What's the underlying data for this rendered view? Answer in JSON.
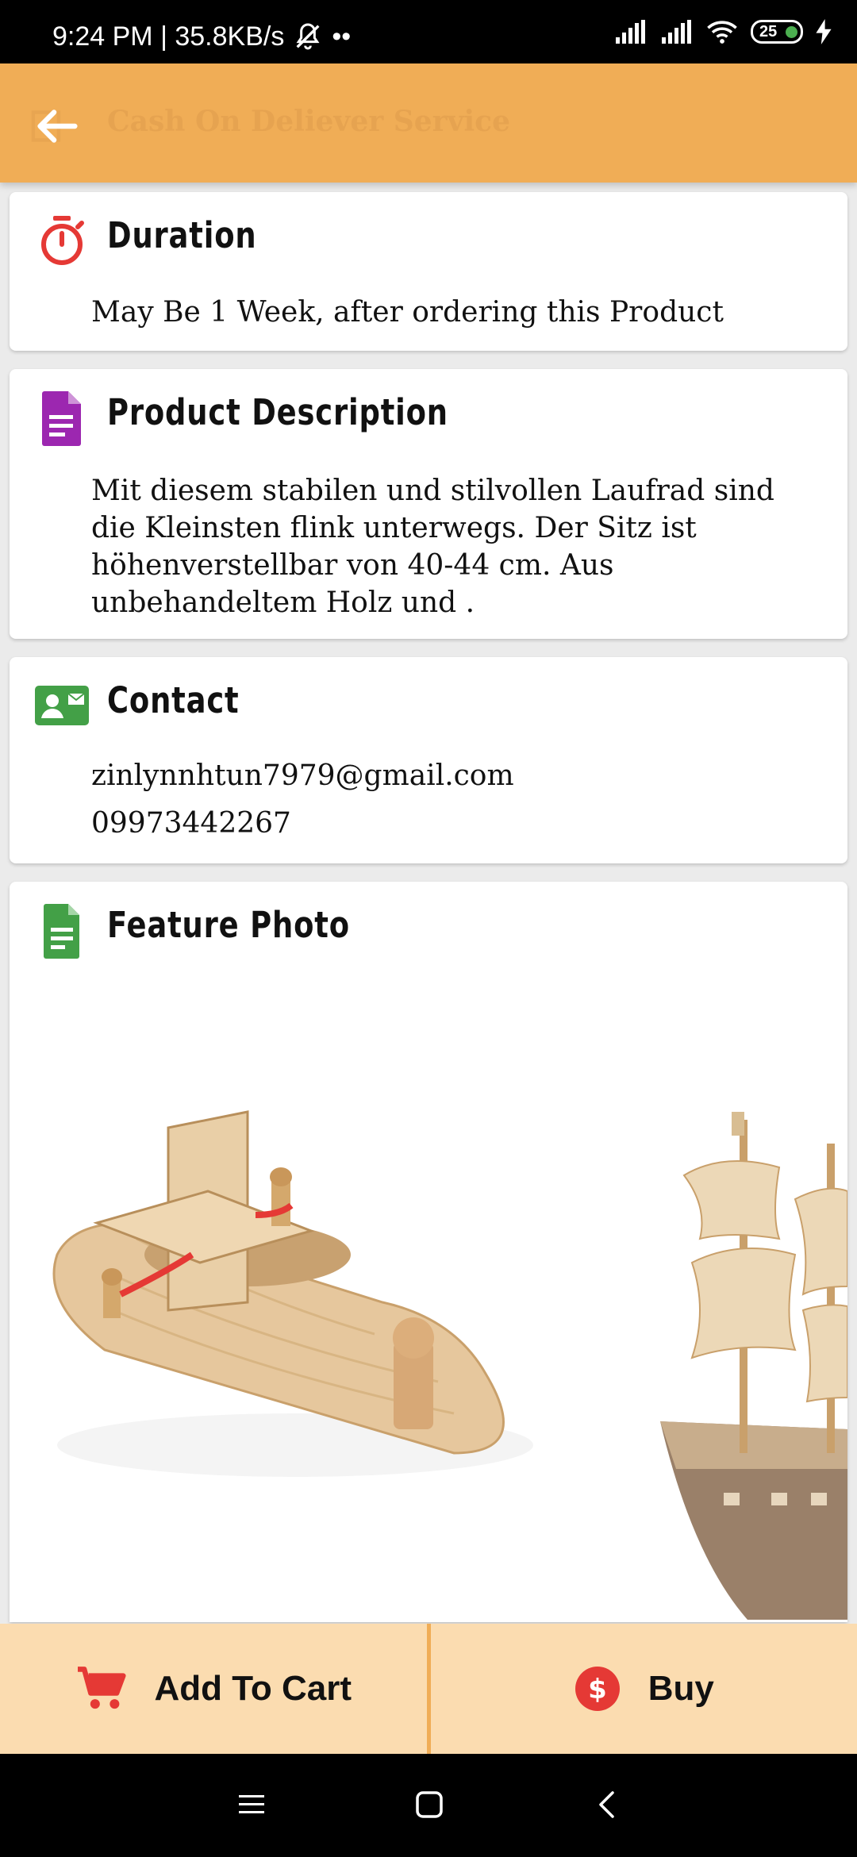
{
  "status_bar": {
    "time_speed": "9:24 PM | 35.8KB/s",
    "extra": "••",
    "battery": "25"
  },
  "app_bar": {
    "title": "Cash On Deliever Service"
  },
  "duration": {
    "heading": "Duration",
    "text": "May Be 1 Week, after ordering this Product",
    "icon": "timer-icon",
    "icon_color": "#e53935"
  },
  "description": {
    "heading": "Product Description",
    "text": "Mit diesem stabilen und stilvollen Laufrad sind die Kleinsten flink unterwegs. Der Sitz ist höhenverstellbar von 40-44 cm. Aus unbehandeltem Holz und .",
    "icon": "document-icon",
    "icon_color": "#9c27b0"
  },
  "contact": {
    "heading": "Contact",
    "email": "zinlynnhtun7979@gmail.com",
    "phone": "09973442267",
    "icon": "contact-card-icon",
    "icon_color": "#43a047"
  },
  "feature": {
    "heading": "Feature Photo",
    "icon": "document-icon",
    "icon_color": "#43a047"
  },
  "actions": {
    "add_to_cart": "Add To Cart",
    "buy": "Buy",
    "accent": "#e53935"
  },
  "colors": {
    "app_bar": "#f0ad56",
    "bottom_bar": "#fbdcb0"
  }
}
